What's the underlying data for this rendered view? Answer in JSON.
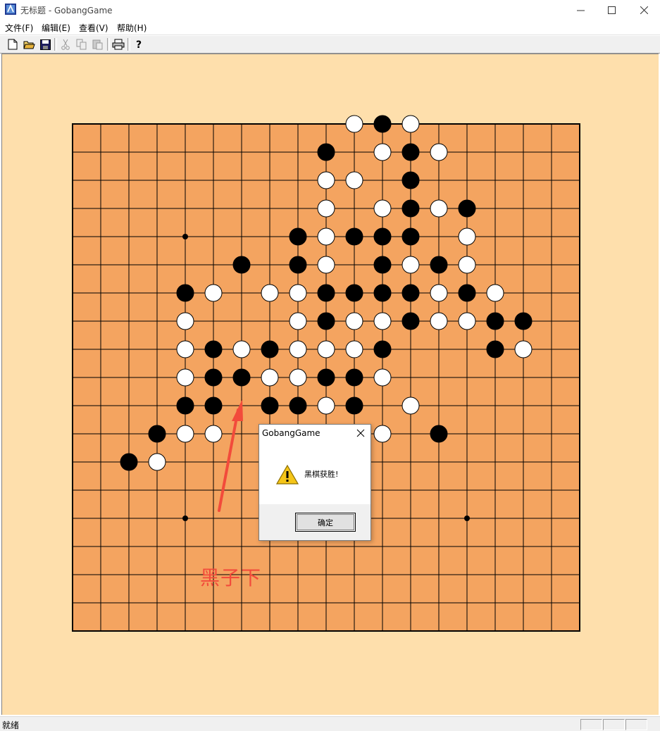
{
  "window": {
    "title": "无标题 - GobangGame"
  },
  "menu": [
    "文件(F)",
    "编辑(E)",
    "查看(V)",
    "帮助(H)"
  ],
  "toolbar": {
    "icons": [
      "new-file-icon",
      "open-folder-icon",
      "save-icon",
      "cut-icon",
      "copy-icon",
      "paste-icon",
      "print-icon",
      "help-icon"
    ]
  },
  "board": {
    "size": 19,
    "star_points": [
      [
        4,
        4
      ],
      [
        14,
        4
      ],
      [
        4,
        14
      ],
      [
        14,
        14
      ]
    ],
    "colors": {
      "board": "#f4a460",
      "background": "#fedfac",
      "line": "#000000"
    },
    "black": [
      [
        11,
        0
      ],
      [
        9,
        1
      ],
      [
        12,
        1
      ],
      [
        12,
        2
      ],
      [
        12,
        3
      ],
      [
        14,
        3
      ],
      [
        8,
        4
      ],
      [
        10,
        4
      ],
      [
        11,
        4
      ],
      [
        12,
        4
      ],
      [
        6,
        5
      ],
      [
        8,
        5
      ],
      [
        11,
        5
      ],
      [
        13,
        5
      ],
      [
        4,
        6
      ],
      [
        9,
        6
      ],
      [
        10,
        6
      ],
      [
        11,
        6
      ],
      [
        12,
        6
      ],
      [
        14,
        6
      ],
      [
        9,
        7
      ],
      [
        12,
        7
      ],
      [
        15,
        7
      ],
      [
        16,
        7
      ],
      [
        5,
        8
      ],
      [
        7,
        8
      ],
      [
        11,
        8
      ],
      [
        15,
        8
      ],
      [
        5,
        9
      ],
      [
        6,
        9
      ],
      [
        9,
        9
      ],
      [
        10,
        9
      ],
      [
        4,
        10
      ],
      [
        5,
        10
      ],
      [
        7,
        10
      ],
      [
        8,
        10
      ],
      [
        10,
        10
      ],
      [
        3,
        11
      ],
      [
        13,
        11
      ],
      [
        2,
        12
      ]
    ],
    "white": [
      [
        10,
        0
      ],
      [
        12,
        0
      ],
      [
        11,
        1
      ],
      [
        13,
        1
      ],
      [
        9,
        2
      ],
      [
        10,
        2
      ],
      [
        9,
        3
      ],
      [
        11,
        3
      ],
      [
        13,
        3
      ],
      [
        9,
        4
      ],
      [
        14,
        4
      ],
      [
        9,
        5
      ],
      [
        12,
        5
      ],
      [
        14,
        5
      ],
      [
        5,
        6
      ],
      [
        7,
        6
      ],
      [
        8,
        6
      ],
      [
        13,
        6
      ],
      [
        15,
        6
      ],
      [
        4,
        7
      ],
      [
        8,
        7
      ],
      [
        10,
        7
      ],
      [
        11,
        7
      ],
      [
        13,
        7
      ],
      [
        14,
        7
      ],
      [
        4,
        8
      ],
      [
        6,
        8
      ],
      [
        8,
        8
      ],
      [
        9,
        8
      ],
      [
        10,
        8
      ],
      [
        16,
        8
      ],
      [
        4,
        9
      ],
      [
        7,
        9
      ],
      [
        8,
        9
      ],
      [
        11,
        9
      ],
      [
        9,
        10
      ],
      [
        12,
        10
      ],
      [
        4,
        11
      ],
      [
        5,
        11
      ],
      [
        11,
        11
      ],
      [
        3,
        12
      ]
    ]
  },
  "annotation": {
    "text": "黑子下",
    "color": "#f24b3b"
  },
  "dialog": {
    "title": "GobangGame",
    "message": "黑棋获胜!",
    "ok_label": "确定"
  },
  "status": {
    "text": "就绪"
  }
}
